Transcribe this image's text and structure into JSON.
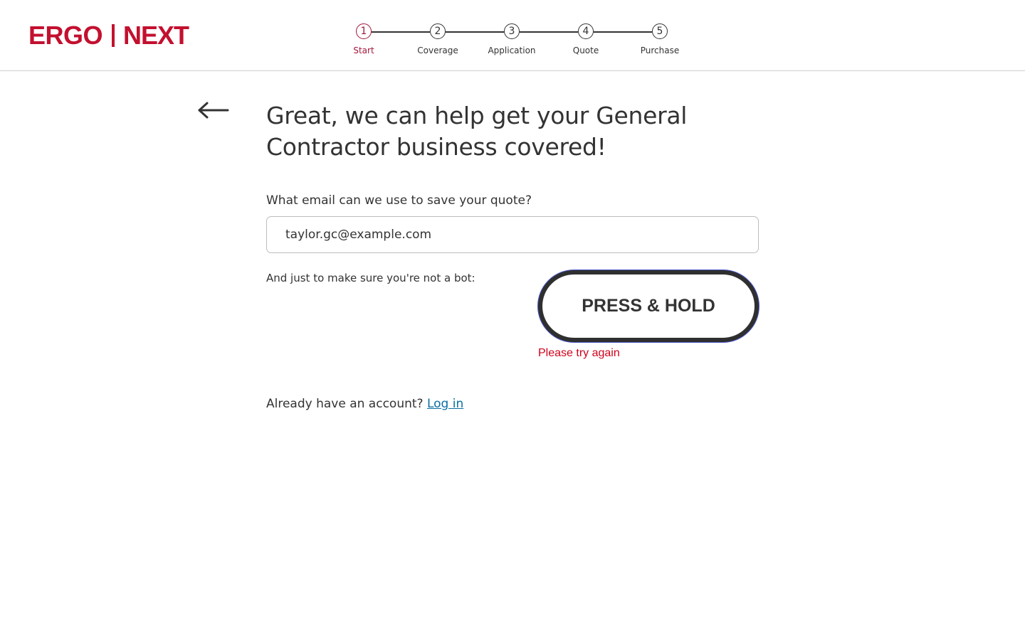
{
  "header": {
    "logo": {
      "part1": "ERGO",
      "part2": "NEXT",
      "brand_color": "#c3102f"
    },
    "steps": [
      {
        "number": "1",
        "label": "Start",
        "active": true
      },
      {
        "number": "2",
        "label": "Coverage",
        "active": false
      },
      {
        "number": "3",
        "label": "Application",
        "active": false
      },
      {
        "number": "4",
        "label": "Quote",
        "active": false
      },
      {
        "number": "5",
        "label": "Purchase",
        "active": false
      }
    ],
    "active_step_color": "#a3173a"
  },
  "main": {
    "back_icon": "arrow-left-icon",
    "headline": "Great, we can help get your General Contractor business covered!",
    "email": {
      "label": "What email can we use to save your quote?",
      "value": "taylor.gc@example.com"
    },
    "bot_check": {
      "label": "And just to make sure you're not a bot:",
      "button_label": "PRESS & HOLD",
      "error": "Please try again",
      "error_color": "#d0021b"
    },
    "account": {
      "prompt": "Already have an account?",
      "login_label": "Log in",
      "link_color": "#0a6ea4"
    }
  }
}
